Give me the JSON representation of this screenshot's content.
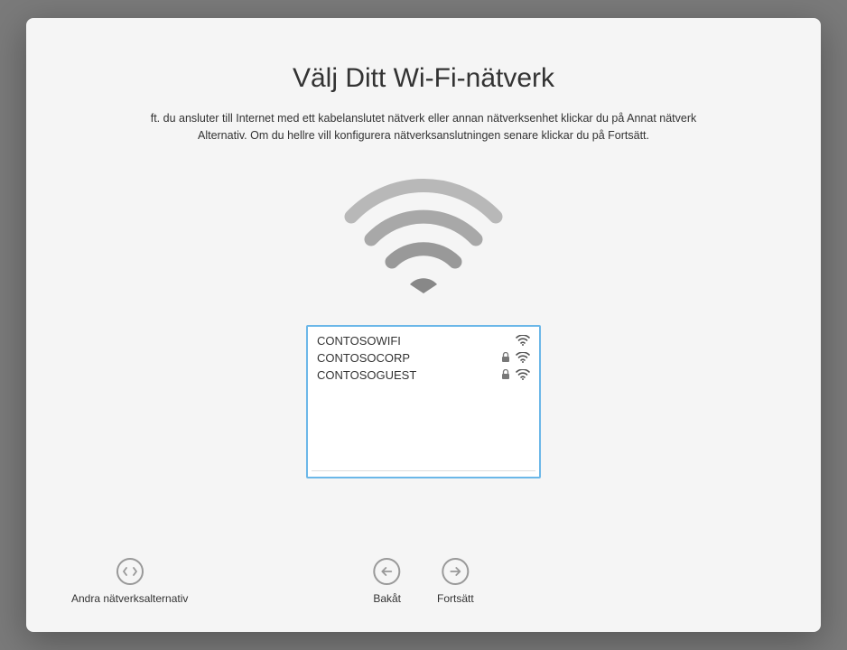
{
  "title": "Välj Ditt Wi-Fi-nätverk",
  "description_line1": "ft. du ansluter till Internet med ett kabelanslutet nätverk eller annan nätverksenhet klickar du på Annat nätverk",
  "description_line2": "Alternativ. Om du hellre vill konfigurera nätverksanslutningen senare klickar du på Fortsätt.",
  "networks": [
    {
      "name": "CONTOSOWIFI",
      "locked": false
    },
    {
      "name": "CONTOSOCORP",
      "locked": true
    },
    {
      "name": "CONTOSOGUEST",
      "locked": true
    }
  ],
  "footer": {
    "other_options": "Andra nätverksalternativ",
    "back": "Bakåt",
    "continue": "Fortsätt"
  }
}
